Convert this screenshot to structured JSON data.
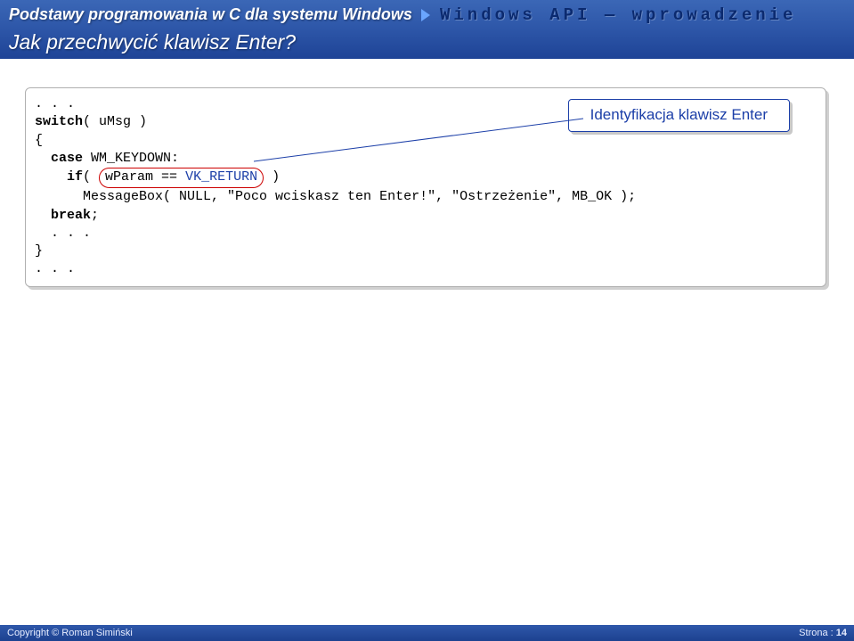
{
  "header": {
    "breadcrumb": "Podstawy programowania w C dla systemu Windows",
    "right": "Windows API — wprowadzenie",
    "title": "Jak przechwycić klawisz Enter?"
  },
  "code": {
    "l1": ". . .",
    "l2a": "switch",
    "l2b": "( uMsg )",
    "l3": "{",
    "l4a": "  ",
    "l4b": "case",
    "l4c": " WM_KEYDOWN:",
    "l5a": "    ",
    "l5b": "if",
    "l5c": "( ",
    "l5d": "wParam == ",
    "l5e": "VK_RETURN",
    "l5f": " )",
    "l6": "      MessageBox( NULL, \"Poco wciskasz ten Enter!\", \"Ostrzeżenie\", MB_OK );",
    "l7a": "  ",
    "l7b": "break",
    "l7c": ";",
    "l8": "  . . .",
    "l9": "}",
    "l10": ". . ."
  },
  "callout": {
    "text": "Identyfikacja klawisz Enter"
  },
  "footer": {
    "left": "Copyright © Roman Simiński",
    "right_label": "Strona : ",
    "page": "14"
  }
}
